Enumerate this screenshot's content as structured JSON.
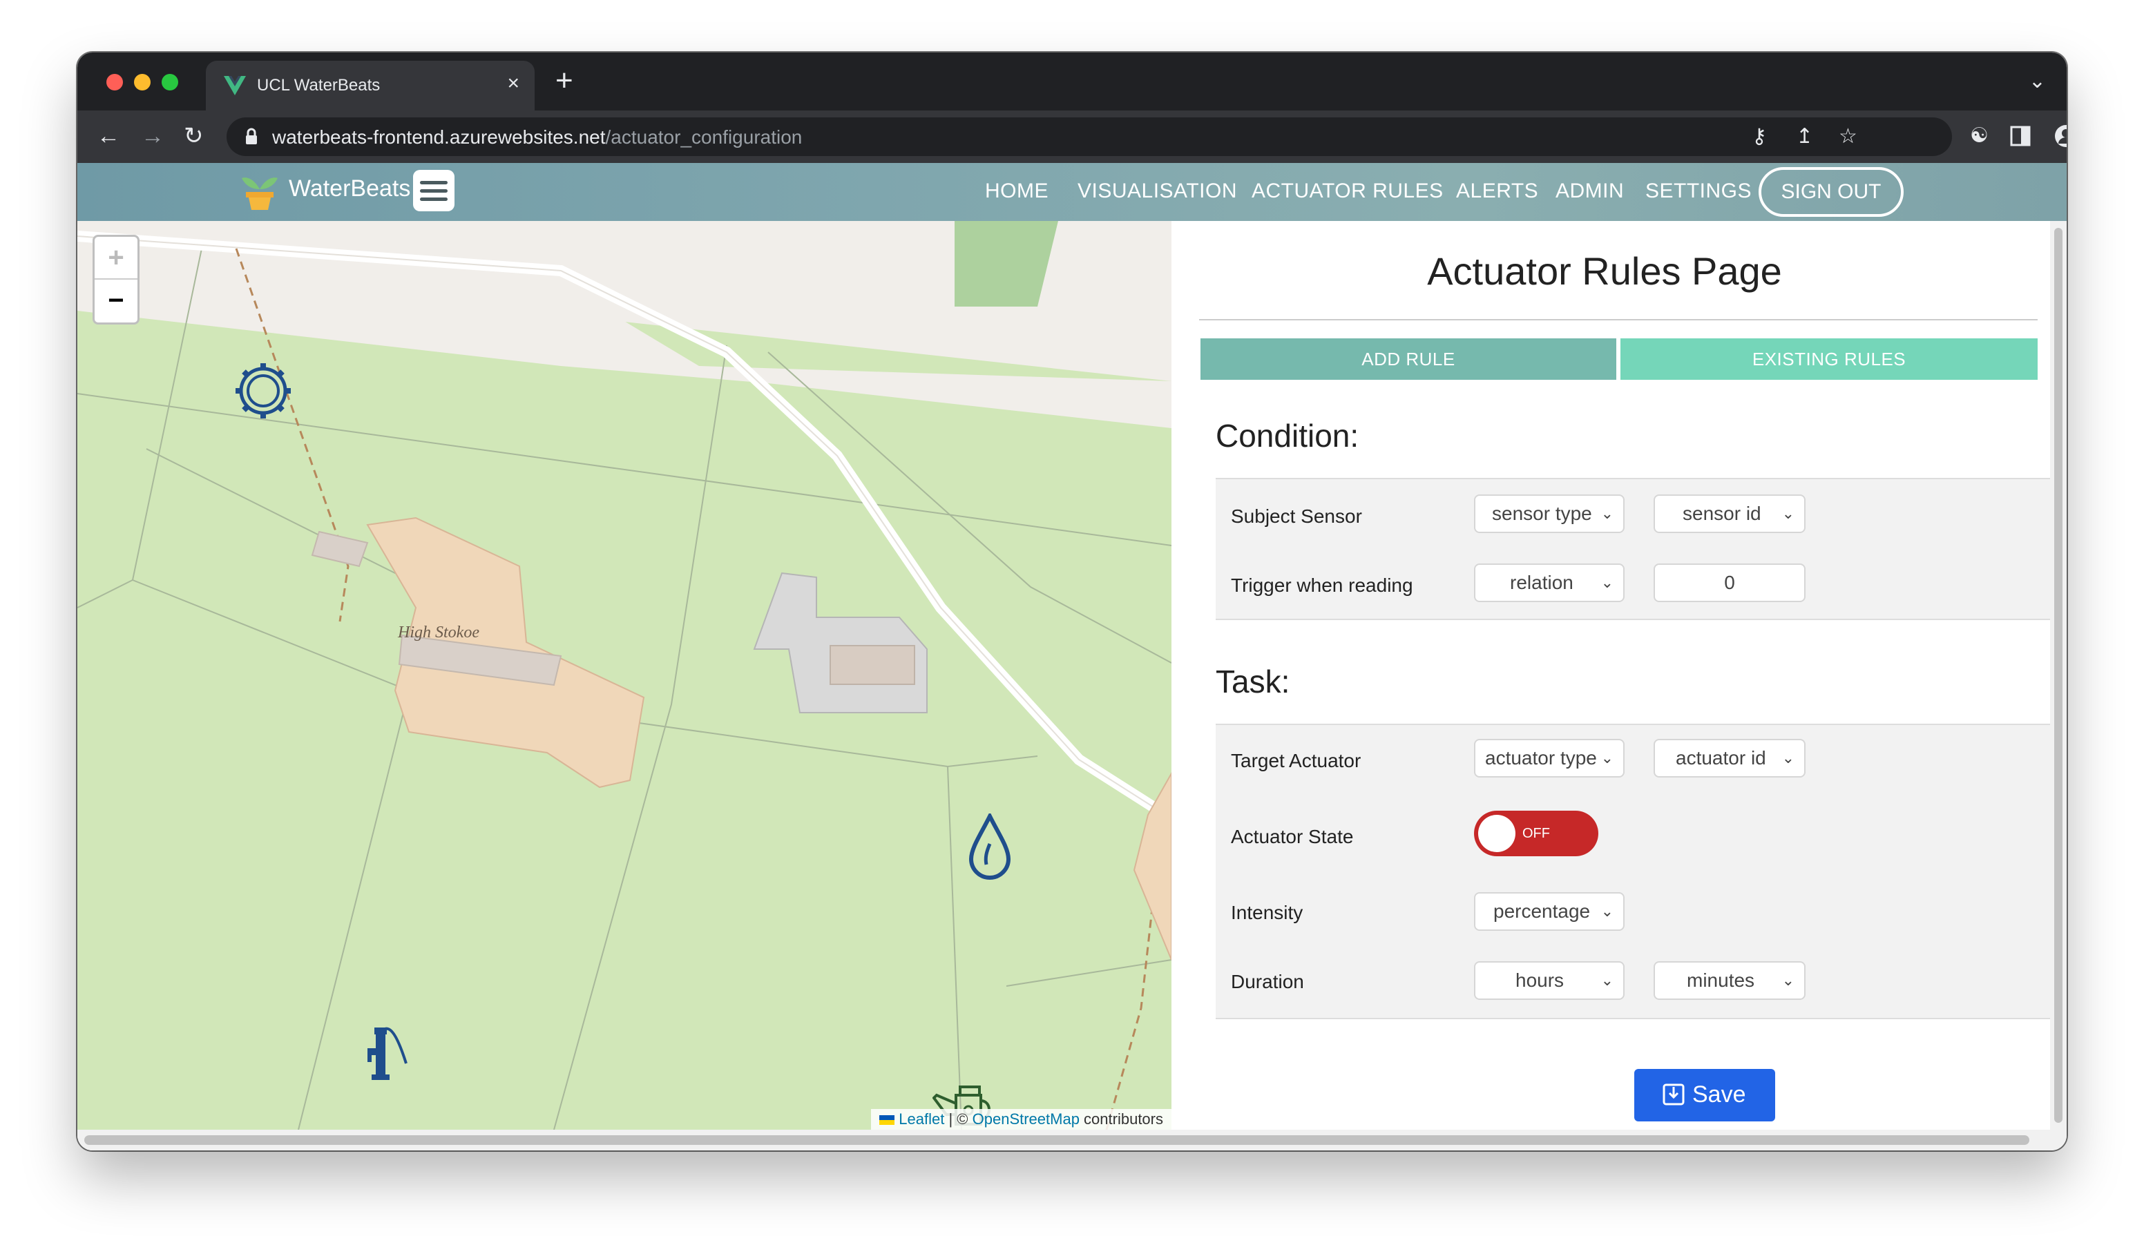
{
  "browser": {
    "tab_title": "UCL WaterBeats",
    "tab_close": "×",
    "new_tab": "+",
    "tabs_menu": "⌄",
    "url_host": "waterbeats-frontend.azurewebsites.net",
    "url_path": "/actuator_configuration",
    "icons": [
      "back-icon",
      "forward-icon",
      "reload-icon",
      "lock-icon",
      "key-icon",
      "share-icon",
      "star-icon",
      "extensions-icon",
      "sidepanel-icon",
      "profile-icon",
      "menu-icon"
    ]
  },
  "navbar": {
    "brand": "WaterBeats",
    "links": [
      "HOME",
      "VISUALISATION",
      "ACTUATOR RULES",
      "ALERTS",
      "ADMIN",
      "SETTINGS"
    ],
    "sign_out": "SIGN OUT"
  },
  "map": {
    "zoom_in": "+",
    "zoom_out": "−",
    "place_label": "High Stokoe",
    "attribution": {
      "leaflet": "Leaflet",
      "separator": " | © ",
      "osm": "OpenStreetMap",
      "suffix": " contributors"
    },
    "markers": [
      "gear-marker",
      "water-drop-marker",
      "water-pump-marker",
      "watering-can-marker"
    ]
  },
  "panel": {
    "title": "Actuator Rules Page",
    "tabs": {
      "add": "ADD RULE",
      "existing": "EXISTING RULES"
    },
    "condition": {
      "heading": "Condition:",
      "subject_label": "Subject Sensor",
      "sensor_type": "sensor type",
      "sensor_id": "sensor id",
      "trigger_label": "Trigger when reading",
      "relation": "relation",
      "threshold": "0"
    },
    "task": {
      "heading": "Task:",
      "target_label": "Target Actuator",
      "actuator_type": "actuator type",
      "actuator_id": "actuator id",
      "state_label": "Actuator State",
      "state_value": "OFF",
      "intensity_label": "Intensity",
      "intensity": "percentage",
      "duration_label": "Duration",
      "hours": "hours",
      "minutes": "minutes"
    },
    "save": "Save"
  },
  "colors": {
    "add_tab": "#76b9ad",
    "existing_tab": "#75d6b9",
    "toggle_off": "#c62828",
    "save_button": "#2264e6",
    "marker_blue": "#1f4e8c",
    "marker_green": "#2e5e2e"
  }
}
